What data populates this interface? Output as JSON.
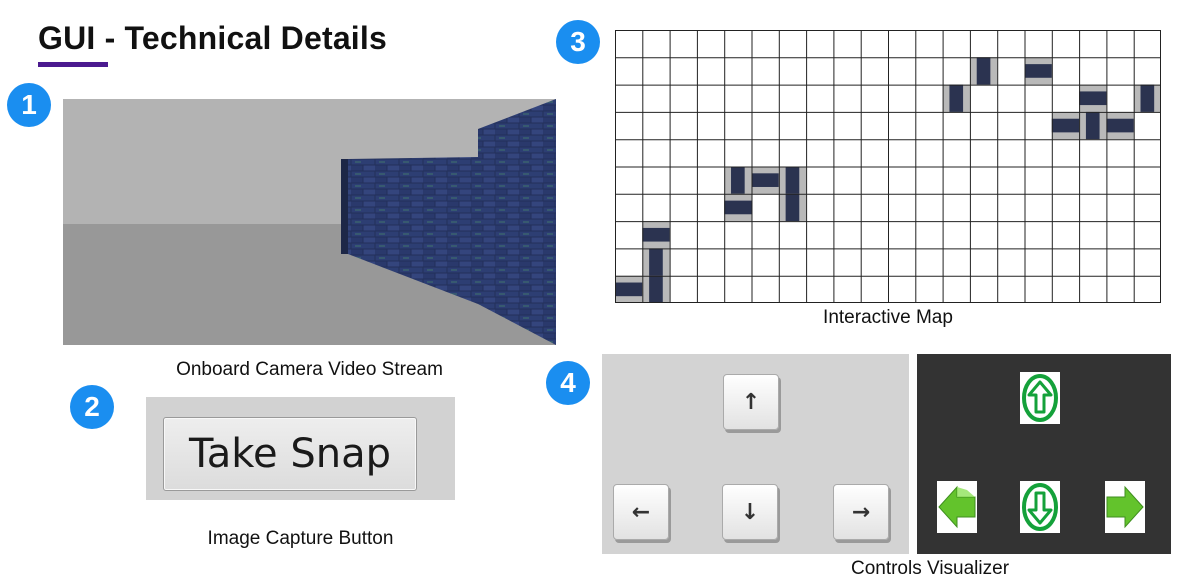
{
  "slide": {
    "title": "GUI - Technical Details"
  },
  "badges": [
    "1",
    "2",
    "3",
    "4"
  ],
  "camera": {
    "caption": "Onboard Camera Video Stream"
  },
  "snap": {
    "button_label": "Take Snap",
    "caption": "Image Capture Button"
  },
  "map": {
    "caption": "Interactive Map",
    "columns": 20,
    "rows": 10,
    "wall_color": "#2b3350",
    "floor_color": "#b9b9b9"
  },
  "controls": {
    "caption": "Controls Visualizer",
    "keys": [
      {
        "name": "up",
        "glyph": "↑"
      },
      {
        "name": "left",
        "glyph": "←"
      },
      {
        "name": "down",
        "glyph": "↓"
      },
      {
        "name": "right",
        "glyph": "→"
      }
    ],
    "visualizer_bg": "#333333",
    "active_color": "#63c32c",
    "outline_color": "#14a13a"
  }
}
